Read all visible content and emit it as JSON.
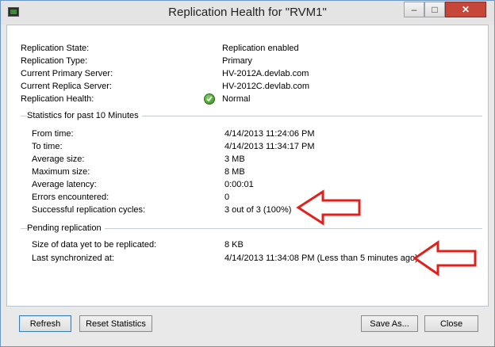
{
  "window": {
    "title": "Replication Health for \"RVM1\""
  },
  "summary": [
    {
      "label": "Replication State:",
      "value": "Replication enabled"
    },
    {
      "label": "Replication Type:",
      "value": "Primary"
    },
    {
      "label": "Current Primary Server:",
      "value": "HV-2012A.devlab.com"
    },
    {
      "label": "Current Replica Server:",
      "value": "HV-2012C.devlab.com"
    },
    {
      "label": "Replication Health:",
      "value": "Normal"
    }
  ],
  "statistics": {
    "header": "Statistics for past 10 Minutes",
    "rows": [
      {
        "label": "From time:",
        "value": "4/14/2013 11:24:06 PM"
      },
      {
        "label": "To time:",
        "value": "4/14/2013 11:34:17 PM"
      },
      {
        "label": "Average size:",
        "value": "3 MB"
      },
      {
        "label": "Maximum size:",
        "value": "8 MB"
      },
      {
        "label": "Average latency:",
        "value": "0:00:01"
      },
      {
        "label": "Errors encountered:",
        "value": "0"
      },
      {
        "label": "Successful replication cycles:",
        "value": "3 out of 3 (100%)"
      }
    ]
  },
  "pending": {
    "header": "Pending replication",
    "rows": [
      {
        "label": "Size of data yet to be replicated:",
        "value": "8 KB"
      },
      {
        "label": "Last synchronized at:",
        "value": "4/14/2013 11:34:08 PM (Less than 5 minutes ago)"
      }
    ]
  },
  "buttons": {
    "refresh": "Refresh",
    "reset": "Reset Statistics",
    "save_as": "Save As...",
    "close": "Close"
  },
  "title_buttons": {
    "minimize": "–",
    "maximize": "□",
    "close": "✕"
  },
  "icons": {
    "app": "hyper-v-window-icon",
    "health": "green-check-icon",
    "annotation": "red-arrow-icon"
  },
  "colors": {
    "health_ok": "#2f8a1c",
    "annotation": "#e0201a",
    "close_button": "#c7463a"
  }
}
